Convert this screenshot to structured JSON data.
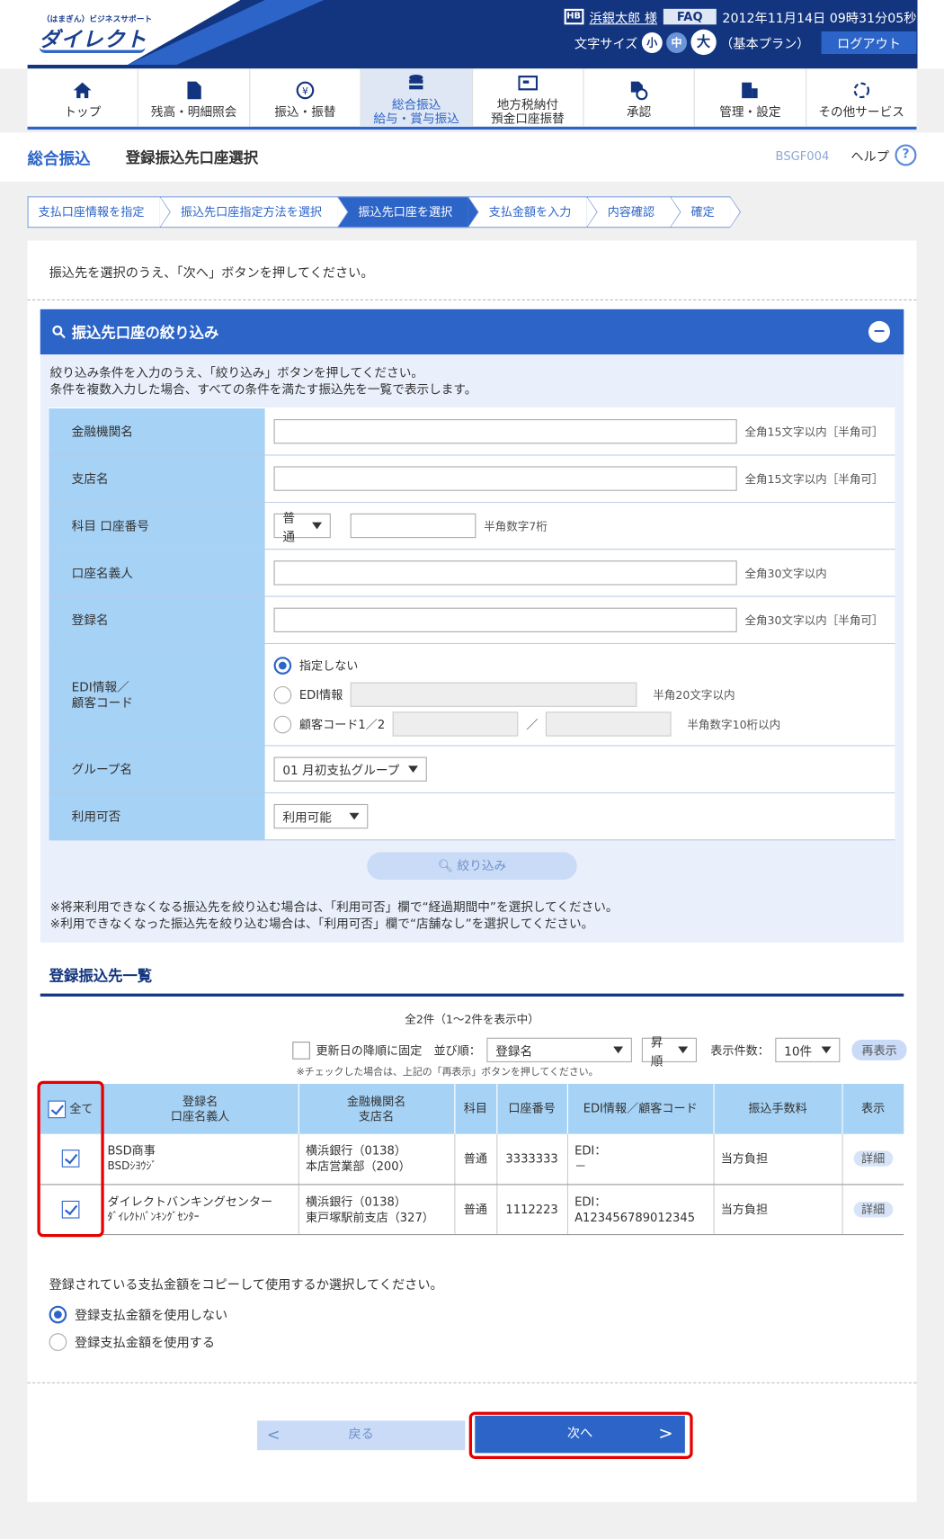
{
  "header": {
    "logo_sub": "（はまぎん）ビジネスサポート",
    "logo_main": "ダイレクト",
    "user_badge": "HB",
    "user": "浜銀太郎 様",
    "faq": "FAQ",
    "datetime": "2012年11月14日 09時31分05秒",
    "fontsize_label": "文字サイズ",
    "fs_small": "小",
    "fs_mid": "中",
    "fs_large": "大",
    "plan": "（基本プラン）",
    "logout": "ログアウト"
  },
  "nav": [
    {
      "label": "トップ",
      "label2": ""
    },
    {
      "label": "残高・明細照会",
      "label2": ""
    },
    {
      "label": "振込・振替",
      "label2": ""
    },
    {
      "label": "総合振込",
      "label2": "給与・賞与振込"
    },
    {
      "label": "地方税納付",
      "label2": "預金口座振替"
    },
    {
      "label": "承認",
      "label2": ""
    },
    {
      "label": "管理・設定",
      "label2": ""
    },
    {
      "label": "その他サービス",
      "label2": ""
    }
  ],
  "title": {
    "section": "総合振込",
    "page": "登録振込先口座選択",
    "page_id": "BSGF004",
    "help": "ヘルプ"
  },
  "steps": [
    "支払口座情報を指定",
    "振込先口座指定方法を選択",
    "振込先口座を選択",
    "支払金額を入力",
    "内容確認",
    "確定"
  ],
  "instruction": "振込先を選択のうえ、「次へ」ボタンを押してください。",
  "filter": {
    "title": "振込先口座の絞り込み",
    "desc1": "絞り込み条件を入力のうえ、「絞り込み」ボタンを押してください。",
    "desc2": "条件を複数入力した場合、すべての条件を満たす振込先を一覧で表示します。",
    "bank_label": "金融機関名",
    "bank_hint": "全角15文字以内［半角可］",
    "branch_label": "支店名",
    "branch_hint": "全角15文字以内［半角可］",
    "account_label": "科目 口座番号",
    "account_type": "普通",
    "account_hint": "半角数字7桁",
    "holder_label": "口座名義人",
    "holder_hint": "全角30文字以内",
    "regname_label": "登録名",
    "regname_hint": "全角30文字以内［半角可］",
    "edi_label1": "EDI情報／",
    "edi_label2": "顧客コード",
    "edi_opt1": "指定しない",
    "edi_opt2": "EDI情報",
    "edi_hint": "半角20文字以内",
    "edi_opt3": "顧客コード1／2",
    "edi_sep": "／",
    "cust_hint": "半角数字10桁以内",
    "group_label": "グループ名",
    "group_value": "01 月初支払グループ",
    "avail_label": "利用可否",
    "avail_value": "利用可能",
    "button": "絞り込み",
    "note1": "※将来利用できなくなる振込先を絞り込む場合は、「利用可否」欄で“経過期間中”を選択してください。",
    "note2": "※利用できなくなった振込先を絞り込む場合は、「利用可否」欄で“店舗なし”を選択してください。"
  },
  "list": {
    "title": "登録振込先一覧",
    "count": "全2件（1～2件を表示中）",
    "fix_order": "更新日の降順に固定",
    "sort_label": "並び順：",
    "sort_value": "登録名",
    "order_value": "昇順",
    "per_page_label": "表示件数：",
    "per_page_value": "10件",
    "redisplay": "再表示",
    "ctrl_note": "※チェックした場合は、上記の「再表示」ボタンを押してください。",
    "headers": {
      "all": "全て",
      "regname": "登録名",
      "holder": "口座名義人",
      "bank": "金融機関名",
      "branch": "支店名",
      "type": "科目",
      "number": "口座番号",
      "edi": "EDI情報／顧客コード",
      "fee": "振込手数料",
      "view": "表示"
    },
    "rows": [
      {
        "regname": "BSD商事",
        "holder": "BSDｼﾖｳｼﾞ",
        "bank": "横浜銀行（0138）",
        "branch": "本店営業部（200）",
        "type": "普通",
        "number": "3333333",
        "edi": "EDI：",
        "edi_val": "－",
        "fee": "当方負担",
        "detail": "詳細"
      },
      {
        "regname": "ダイレクトバンキングセンター",
        "holder": "ﾀﾞｲﾚｸﾄﾊﾞﾝｷﾝｸﾞｾﾝﾀｰ",
        "bank": "横浜銀行（0138）",
        "branch": "東戸塚駅前支店（327）",
        "type": "普通",
        "number": "1112223",
        "edi": "EDI：",
        "edi_val": "A123456789012345",
        "fee": "当方負担",
        "detail": "詳細"
      }
    ]
  },
  "copy": {
    "question": "登録されている支払金額をコピーして使用するか選択してください。",
    "opt1": "登録支払金額を使用しない",
    "opt2": "登録支払金額を使用する"
  },
  "buttons": {
    "back": "戻る",
    "next": "次へ"
  }
}
